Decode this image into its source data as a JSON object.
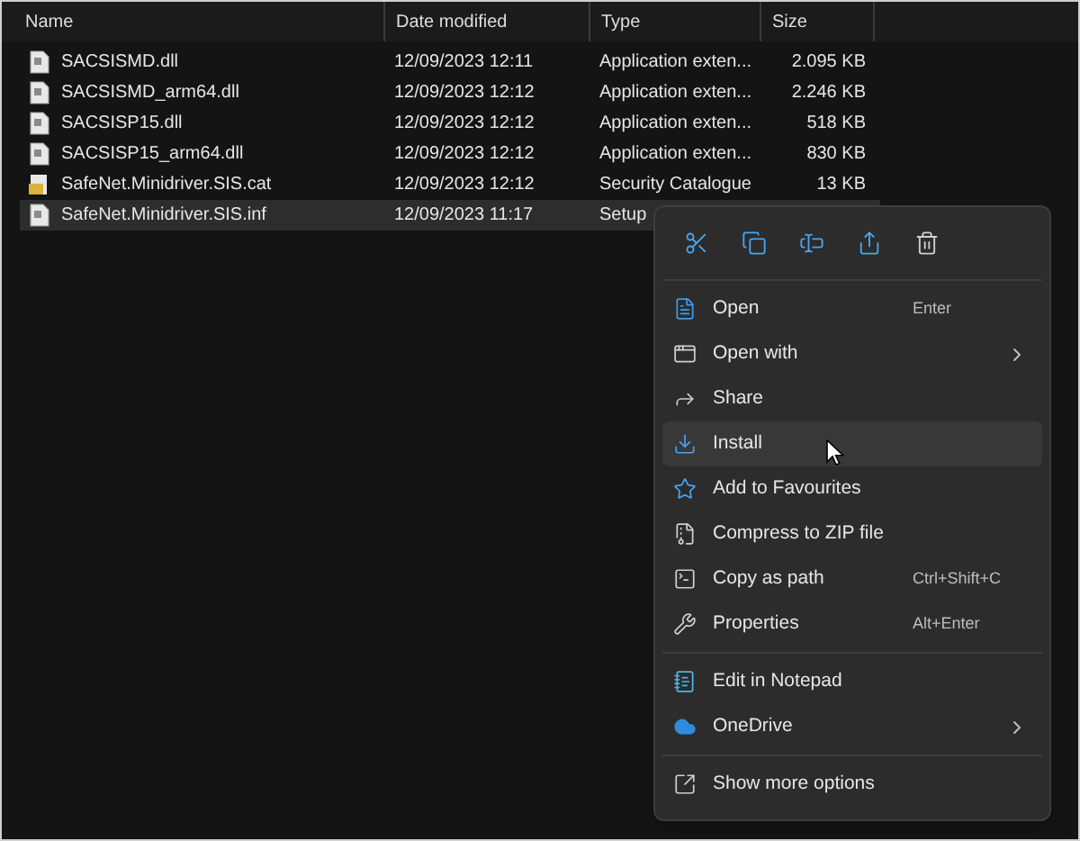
{
  "columns": [
    "Name",
    "Date modified",
    "Type",
    "Size"
  ],
  "files": [
    {
      "name": "SACSISMD.dll",
      "date": "12/09/2023 12:11",
      "type": "Application exten...",
      "size": "2.095 KB",
      "kind": "file",
      "selected": false
    },
    {
      "name": "SACSISMD_arm64.dll",
      "date": "12/09/2023 12:12",
      "type": "Application exten...",
      "size": "2.246 KB",
      "kind": "file",
      "selected": false
    },
    {
      "name": "SACSISP15.dll",
      "date": "12/09/2023 12:12",
      "type": "Application exten...",
      "size": "518 KB",
      "kind": "file",
      "selected": false
    },
    {
      "name": "SACSISP15_arm64.dll",
      "date": "12/09/2023 12:12",
      "type": "Application exten...",
      "size": "830 KB",
      "kind": "file",
      "selected": false
    },
    {
      "name": "SafeNet.Minidriver.SIS.cat",
      "date": "12/09/2023 12:12",
      "type": "Security Catalogue",
      "size": "13 KB",
      "kind": "certificate",
      "selected": false
    },
    {
      "name": "SafeNet.Minidriver.SIS.inf",
      "date": "12/09/2023 11:17",
      "type": "Setup",
      "kind": "file",
      "selected": true
    }
  ],
  "context_menu": {
    "toolbar": [
      {
        "kind": "cut"
      },
      {
        "kind": "copy"
      },
      {
        "kind": "rename"
      },
      {
        "kind": "share"
      },
      {
        "kind": "delete"
      }
    ],
    "sections": [
      [
        {
          "label": "Open",
          "shortcut": "Enter",
          "submenu": false,
          "hovered": false
        },
        {
          "label": "Open with",
          "submenu": true,
          "hovered": false
        },
        {
          "label": "Share",
          "submenu": false,
          "hovered": false
        },
        {
          "label": "Install",
          "submenu": false,
          "hovered": true
        },
        {
          "label": "Add to Favourites",
          "submenu": false,
          "hovered": false
        },
        {
          "label": "Compress to ZIP file",
          "submenu": false,
          "hovered": false
        },
        {
          "label": "Copy as path",
          "shortcut": "Ctrl+Shift+C",
          "submenu": false,
          "hovered": false
        },
        {
          "label": "Properties",
          "shortcut": "Alt+Enter",
          "submenu": false,
          "hovered": false
        }
      ],
      [
        {
          "label": "Edit in Notepad",
          "submenu": false,
          "hovered": false
        },
        {
          "label": "OneDrive",
          "submenu": true,
          "hovered": false
        }
      ],
      [
        {
          "label": "Show more options",
          "submenu": false,
          "hovered": false
        }
      ]
    ]
  }
}
